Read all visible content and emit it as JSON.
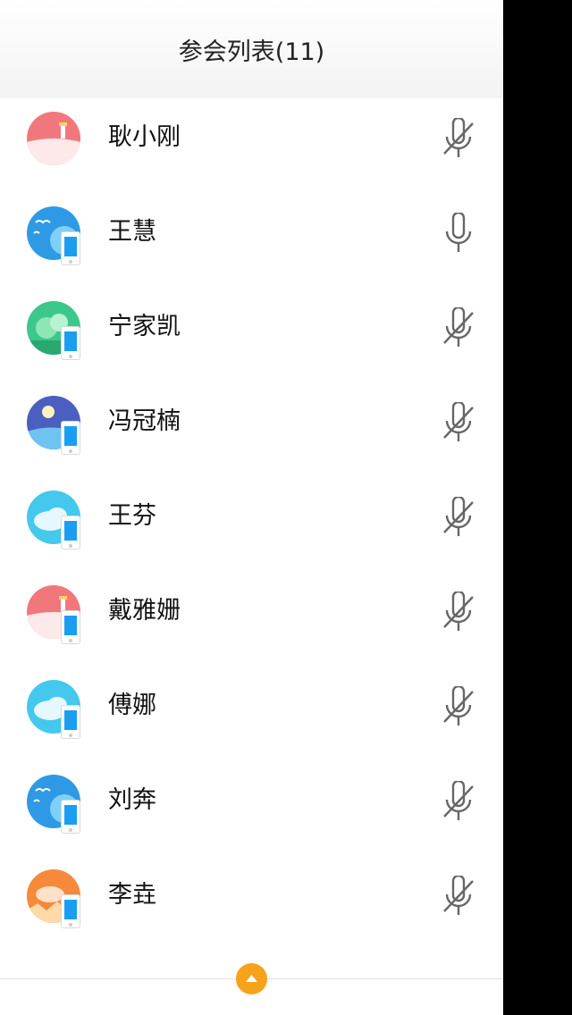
{
  "header": {
    "title": "参会列表(11)"
  },
  "participants": [
    {
      "name": "耿小刚",
      "avatar": "pink-lighthouse",
      "device": "none",
      "mic": "muted"
    },
    {
      "name": "王慧",
      "avatar": "blue-birds",
      "device": "phone",
      "mic": "on"
    },
    {
      "name": "宁家凯",
      "avatar": "green-trees",
      "device": "phone",
      "mic": "muted"
    },
    {
      "name": "冯冠楠",
      "avatar": "indigo-moon",
      "device": "phone",
      "mic": "muted"
    },
    {
      "name": "王芬",
      "avatar": "cyan-cloud",
      "device": "phone",
      "mic": "muted"
    },
    {
      "name": "戴雅姗",
      "avatar": "pink-lighthouse",
      "device": "phone",
      "mic": "muted"
    },
    {
      "name": "傅娜",
      "avatar": "cyan-cloud",
      "device": "phone",
      "mic": "muted"
    },
    {
      "name": "刘奔",
      "avatar": "blue-birds",
      "device": "phone",
      "mic": "muted"
    },
    {
      "name": "李垚",
      "avatar": "orange-sunset",
      "device": "phone",
      "mic": "muted"
    }
  ],
  "footer": {
    "expand_icon": "caret-up-icon",
    "accent": "#f7a21b"
  },
  "colors": {
    "avatar_pink": "#f0787c",
    "avatar_blue": "#2e9ae6",
    "avatar_green": "#3cc88a",
    "avatar_indigo": "#4a5fc0",
    "avatar_cyan": "#45c8ee",
    "avatar_orange": "#f6893a",
    "phone_screen": "#1a9ff0"
  }
}
